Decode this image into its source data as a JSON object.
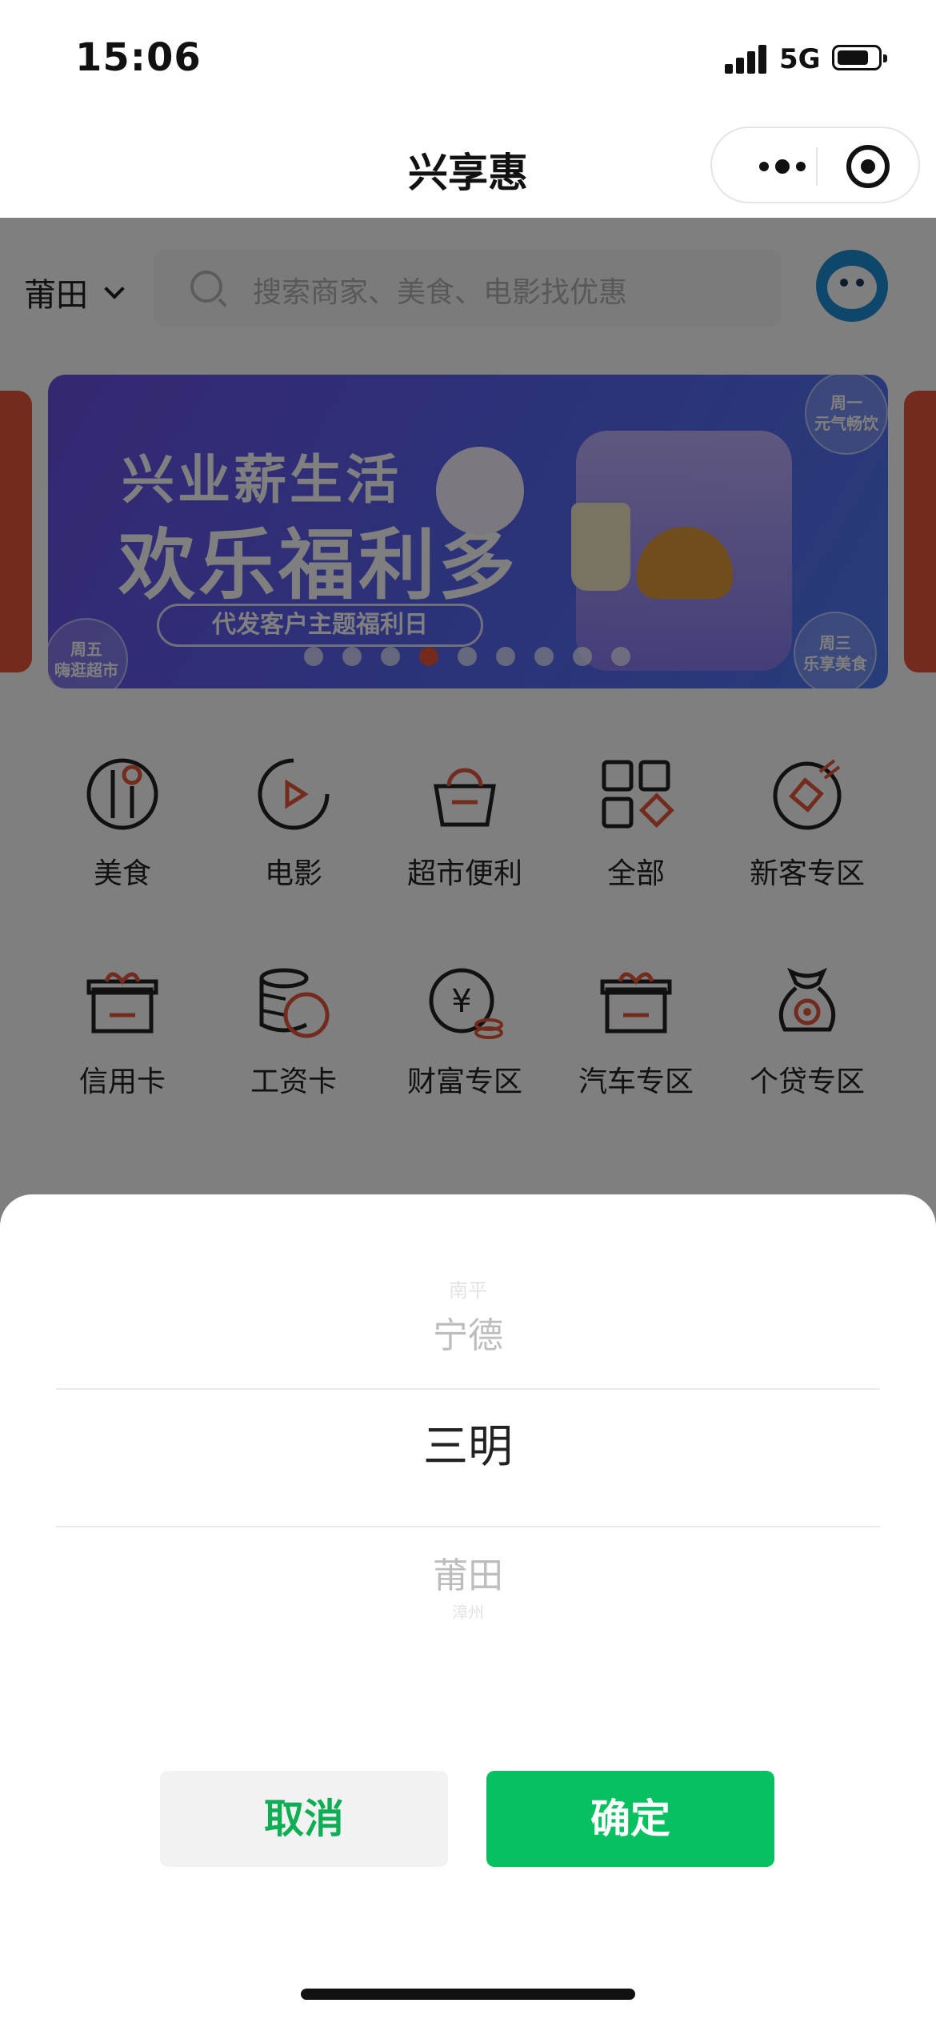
{
  "status_bar": {
    "time": "15:06",
    "network": "5G"
  },
  "nav": {
    "title": "兴享惠"
  },
  "header": {
    "city": "莆田",
    "search_placeholder": "搜索商家、美食、电影找优惠"
  },
  "banner": {
    "title_line1": "兴业薪生活",
    "title_line2": "欢乐福利多",
    "pill": "代发客户主题福利日",
    "bubble_mon": "周一\n元气畅饮",
    "bubble_wed": "周三\n乐享美食",
    "bubble_fri": "周五\n嗨逛超市",
    "dot_count": 9,
    "active_dot_index": 3
  },
  "categories": [
    {
      "label": "美食",
      "icon": "fork-spoon-icon"
    },
    {
      "label": "电影",
      "icon": "play-icon"
    },
    {
      "label": "超市便利",
      "icon": "basket-icon"
    },
    {
      "label": "全部",
      "icon": "grid-icon"
    },
    {
      "label": "新客专区",
      "icon": "new-tag-icon"
    },
    {
      "label": "信用卡",
      "icon": "gift-box-icon"
    },
    {
      "label": "工资卡",
      "icon": "coins-icon"
    },
    {
      "label": "财富专区",
      "icon": "yen-icon"
    },
    {
      "label": "汽车专区",
      "icon": "gift-box-icon"
    },
    {
      "label": "个贷专区",
      "icon": "money-bag-icon"
    }
  ],
  "picker": {
    "faint_top": "南平",
    "prev": "宁德",
    "selected": "三明",
    "next": "莆田",
    "faint_bottom": "漳州"
  },
  "actions": {
    "cancel": "取消",
    "confirm": "确定"
  },
  "colors": {
    "accent_red": "#e4563b",
    "confirm_green": "#07c160",
    "cancel_text_green": "#0fae55"
  }
}
